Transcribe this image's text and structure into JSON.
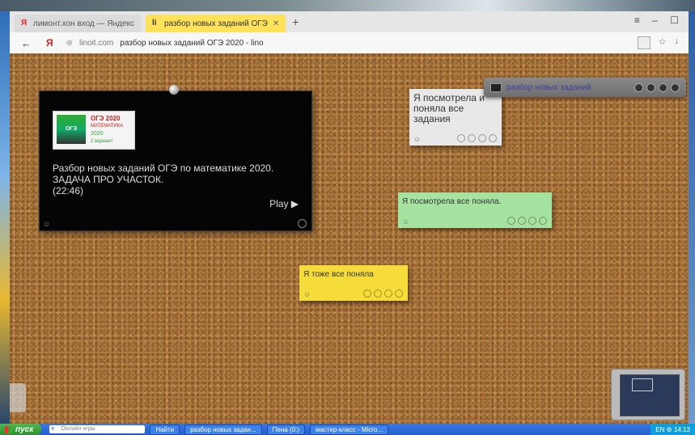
{
  "tabs": [
    {
      "label": "лимонт.хон вход — Яндекс",
      "icon": "yandex-icon"
    },
    {
      "label": "разбор новых заданий ОГЭ",
      "icon": "linoit-icon"
    }
  ],
  "address": {
    "domain": "linoit.com",
    "title": "разбор новых заданий ОГЭ 2020 - lino"
  },
  "video": {
    "thumb_line1": "ОГЭ 2020",
    "thumb_line2": "МАТЕМАТИКА",
    "thumb_line3": "2020",
    "thumb_line4": "2 вариант",
    "thumb_logo": "ОГЭ",
    "title": "Разбор новых заданий ОГЭ по математике 2020. ЗАДАЧА ПРО УЧАСТОК.",
    "duration": "(22:46)",
    "play_label": "Play ▶"
  },
  "notes": [
    {
      "text": "Я посмотрела и поняла все задания",
      "color": "#e8e8e8"
    },
    {
      "text": "Я посмотрела все поняла.",
      "color": "#a6e3a0"
    },
    {
      "text": "Я тоже все поняла",
      "color": "#f5dc3a"
    }
  ],
  "panel": {
    "label": "разбор новых заданий"
  },
  "taskbar": {
    "start": "пуск",
    "search": "Онлайн игры",
    "quick": "Найти",
    "items": [
      "разбор новых задан...",
      "Пена (0:)",
      "мастер-класс - Micro..."
    ],
    "tray": "EN ⚙ 14:13"
  }
}
